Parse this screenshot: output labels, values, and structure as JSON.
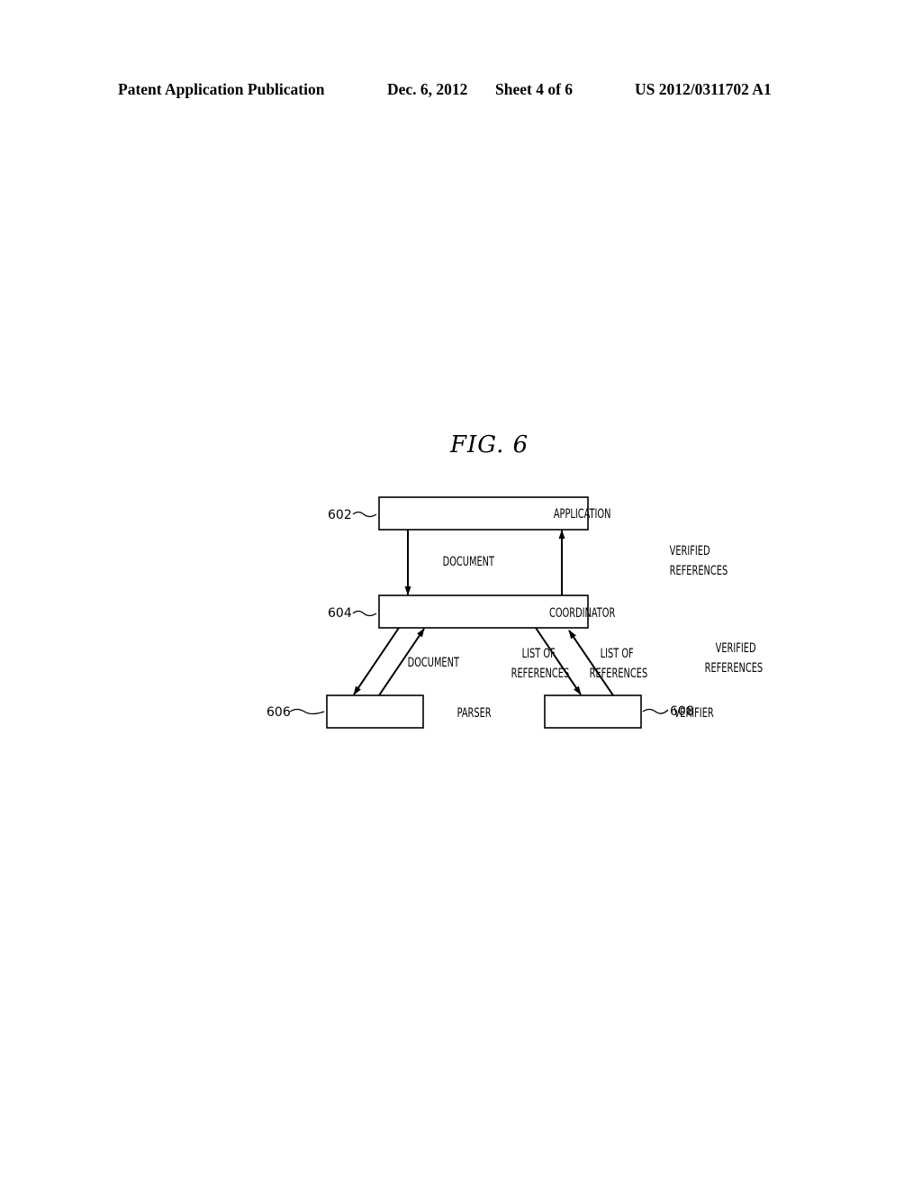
{
  "header": {
    "publication_label": "Patent Application Publication",
    "date": "Dec. 6, 2012",
    "sheet": "Sheet 4 of 6",
    "publication_number": "US 2012/0311702 A1"
  },
  "figure": {
    "title": "FIG. 6",
    "nodes": [
      {
        "id": "application",
        "label": "APPLICATION",
        "ref": "602"
      },
      {
        "id": "coordinator",
        "label": "COORDINATOR",
        "ref": "604"
      },
      {
        "id": "parser",
        "label": "PARSER",
        "ref": "606"
      },
      {
        "id": "verifier",
        "label": "VERIFIER",
        "ref": "608"
      }
    ],
    "edges": [
      {
        "from": "application",
        "to": "coordinator",
        "label": [
          "DOCUMENT"
        ]
      },
      {
        "from": "coordinator",
        "to": "application",
        "label": [
          "VERIFIED",
          "REFERENCES"
        ]
      },
      {
        "from": "coordinator",
        "to": "parser",
        "label": [
          "DOCUMENT"
        ]
      },
      {
        "from": "parser",
        "to": "coordinator",
        "label": [
          "LIST OF",
          "REFERENCES"
        ]
      },
      {
        "from": "coordinator",
        "to": "verifier",
        "label": [
          "LIST OF",
          "REFERENCES"
        ]
      },
      {
        "from": "verifier",
        "to": "coordinator",
        "label": [
          "VERIFIED",
          "REFERENCES"
        ]
      }
    ]
  }
}
